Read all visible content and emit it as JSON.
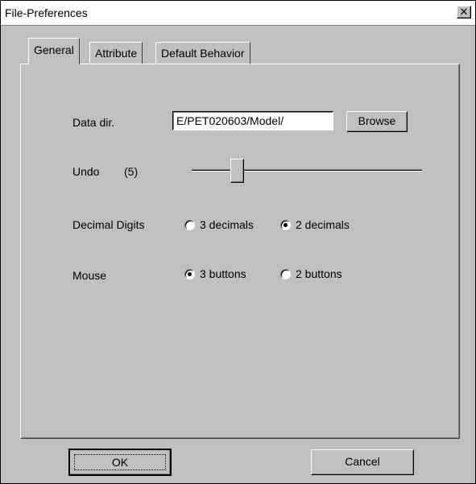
{
  "window": {
    "title": "File-Preferences",
    "close_glyph": "✕"
  },
  "tabs": [
    {
      "label": "General",
      "active": true
    },
    {
      "label": "Attribute",
      "active": false
    },
    {
      "label": "Default Behavior",
      "active": false
    }
  ],
  "general": {
    "data_dir": {
      "label": "Data dir.",
      "value": "E/PET020603/Model/",
      "browse_label": "Browse"
    },
    "undo": {
      "label": "Undo",
      "count_text": "(5)",
      "level_fraction": 0.18
    },
    "decimal_digits": {
      "label": "Decimal Digits",
      "options": [
        {
          "label": "3 decimals",
          "checked": false
        },
        {
          "label": "2 decimals",
          "checked": true
        }
      ]
    },
    "mouse": {
      "label": "Mouse",
      "options": [
        {
          "label": "3 buttons",
          "checked": true
        },
        {
          "label": "2 buttons",
          "checked": false
        }
      ]
    }
  },
  "footer": {
    "ok_label": "OK",
    "cancel_label": "Cancel"
  },
  "colors": {
    "face": "#c0c0c0",
    "shadow": "#808080",
    "highlight": "#ffffff",
    "dark": "#000000"
  }
}
